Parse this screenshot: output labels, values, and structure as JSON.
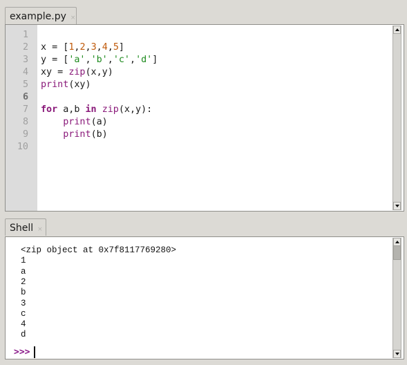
{
  "editor": {
    "tab": {
      "label": "example.py",
      "close": "×"
    },
    "current_line": 6,
    "line_numbers": [
      "1",
      "2",
      "3",
      "4",
      "5",
      "6",
      "7",
      "8",
      "9",
      "10"
    ],
    "lines": [
      [],
      [
        {
          "t": "x = ["
        },
        {
          "t": "1",
          "c": "num"
        },
        {
          "t": ","
        },
        {
          "t": "2",
          "c": "num"
        },
        {
          "t": ","
        },
        {
          "t": "3",
          "c": "num"
        },
        {
          "t": ","
        },
        {
          "t": "4",
          "c": "num"
        },
        {
          "t": ","
        },
        {
          "t": "5",
          "c": "num"
        },
        {
          "t": "]"
        }
      ],
      [
        {
          "t": "y = ["
        },
        {
          "t": "'a'",
          "c": "str"
        },
        {
          "t": ","
        },
        {
          "t": "'b'",
          "c": "str"
        },
        {
          "t": ","
        },
        {
          "t": "'c'",
          "c": "str"
        },
        {
          "t": ","
        },
        {
          "t": "'d'",
          "c": "str"
        },
        {
          "t": "]"
        }
      ],
      [
        {
          "t": "xy = "
        },
        {
          "t": "zip",
          "c": "bi"
        },
        {
          "t": "(x,y)"
        }
      ],
      [
        {
          "t": "print",
          "c": "bi"
        },
        {
          "t": "(xy)"
        }
      ],
      [],
      [
        {
          "t": "for",
          "c": "kw"
        },
        {
          "t": " a,b "
        },
        {
          "t": "in",
          "c": "kw"
        },
        {
          "t": " "
        },
        {
          "t": "zip",
          "c": "bi"
        },
        {
          "t": "(x,y):"
        }
      ],
      [
        {
          "t": "    "
        },
        {
          "t": "print",
          "c": "bi"
        },
        {
          "t": "(a)"
        }
      ],
      [
        {
          "t": "    "
        },
        {
          "t": "print",
          "c": "bi"
        },
        {
          "t": "(b)"
        }
      ],
      []
    ]
  },
  "shell": {
    "tab": {
      "label": "Shell",
      "close": "×"
    },
    "output": [
      "<zip object at 0x7f8117769280>",
      "1",
      "a",
      "2",
      "b",
      "3",
      "c",
      "4",
      "d"
    ],
    "prompt": ">>>"
  },
  "colors": {
    "number": "#c05a0a",
    "string": "#1d8a1d",
    "builtin": "#8a1a7a",
    "prompt": "#8a1a8a"
  }
}
